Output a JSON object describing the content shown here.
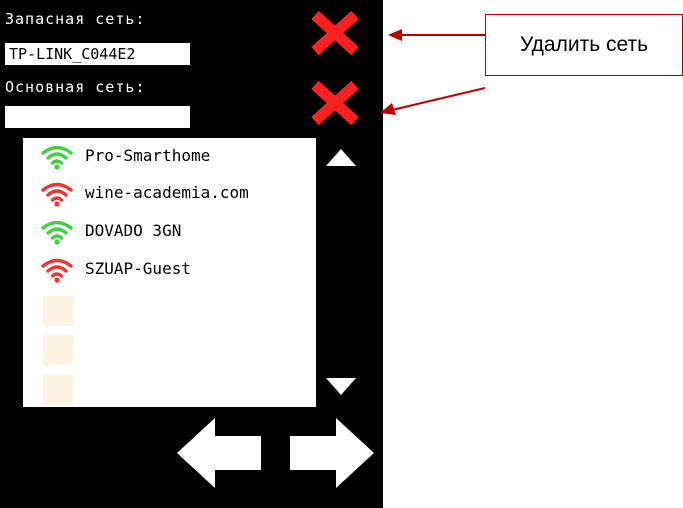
{
  "backup": {
    "label": "Запасная сеть:",
    "ssid": "TP-LINK_C044E2"
  },
  "main": {
    "label": "Основная сеть:",
    "ssid": ""
  },
  "networks": [
    {
      "ssid": "Pro-Smarthome",
      "signal_color": "#3fd23f"
    },
    {
      "ssid": "wine-academia.com",
      "signal_color": "#ef3232"
    },
    {
      "ssid": "DOVADO 3GN",
      "signal_color": "#3fd23f"
    },
    {
      "ssid": "SZUAP-Guest",
      "signal_color": "#ef3232"
    }
  ],
  "empty_slots": 3,
  "annotation": {
    "text": "Удалить сеть"
  },
  "colors": {
    "screen_bg": "#000000",
    "delete_icon": "#ff2020",
    "callout_border": "#c00000",
    "empty_slot": "#fcf3e2"
  },
  "icons": {
    "delete": "close-x-icon",
    "wifi": "wifi-signal-icon",
    "scroll_up": "triangle-up-icon",
    "scroll_down": "triangle-down-icon",
    "prev": "arrow-left-icon",
    "next": "arrow-right-icon"
  }
}
